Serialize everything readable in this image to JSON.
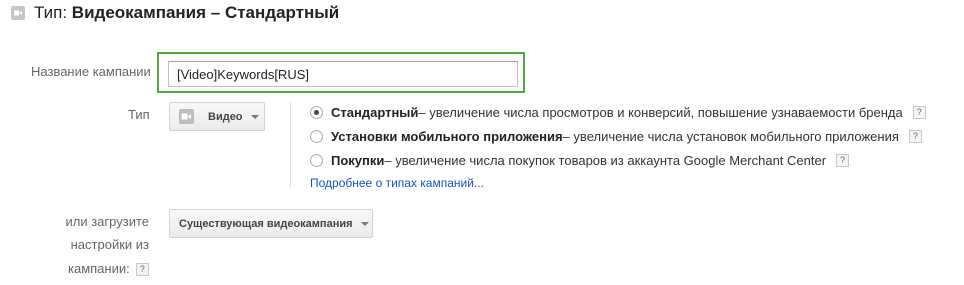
{
  "header": {
    "prefix": "Тип: ",
    "title": "Видеокампания – Стандартный"
  },
  "form": {
    "campaign_name": {
      "label": "Название кампании",
      "value": "[Video]Keywords[RUS]"
    },
    "type": {
      "label": "Тип",
      "dropdown_value": "Видео",
      "options": [
        {
          "title": "Стандартный",
          "description": " – увеличение числа просмотров и конверсий, повышение узнаваемости бренда",
          "selected": true
        },
        {
          "title": "Установки мобильного приложения",
          "description": " – увеличение числа установок мобильного приложения",
          "selected": false
        },
        {
          "title": "Покупки",
          "description": " – увеличение числа покупок товаров из аккаунта Google Merchant Center",
          "selected": false
        }
      ],
      "learn_more_link": "Подробнее о типах кампаний..."
    },
    "load_settings": {
      "label_line1": "или загрузите",
      "label_line2": "настройки из",
      "label_line3": "кампании:",
      "dropdown_value": "Существующая видеокампания"
    }
  },
  "help_glyph": "?",
  "icons": {
    "header": "video-camera-icon",
    "type_dropdown": "video-camera-icon",
    "caret": "caret-down-icon"
  },
  "colors": {
    "highlight_border": "#53a93f",
    "link": "#1155cc"
  }
}
